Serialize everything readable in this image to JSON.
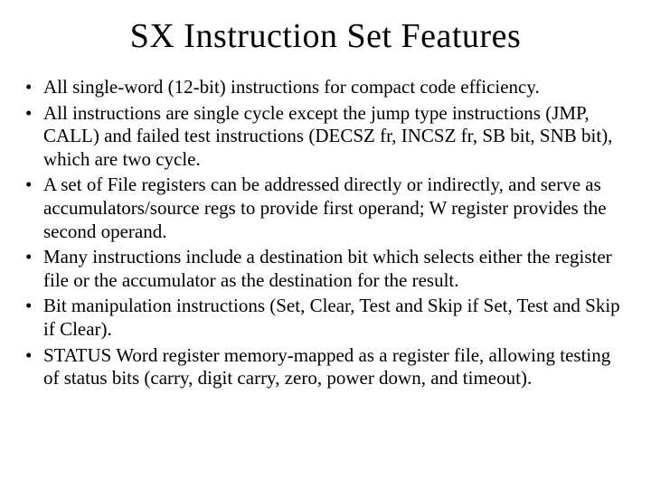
{
  "slide": {
    "title": "SX Instruction Set Features",
    "bullets": [
      "All single-word (12-bit) instructions for compact code efficiency.",
      "All instructions are single cycle except the jump type instructions (JMP, CALL) and failed test instructions (DECSZ fr, INCSZ fr, SB bit, SNB bit), which are two cycle.",
      "A set of File registers can be addressed directly or indirectly, and serve as accumulators/source regs to provide first operand; W register provides the second operand.",
      "Many instructions include a destination bit which selects either the register file or the accumulator as the destination for the result.",
      "Bit manipulation instructions (Set, Clear, Test and Skip if Set, Test and Skip if Clear).",
      "STATUS Word register memory-mapped as a register file, allowing testing of status bits (carry, digit carry, zero, power down, and timeout)."
    ]
  }
}
